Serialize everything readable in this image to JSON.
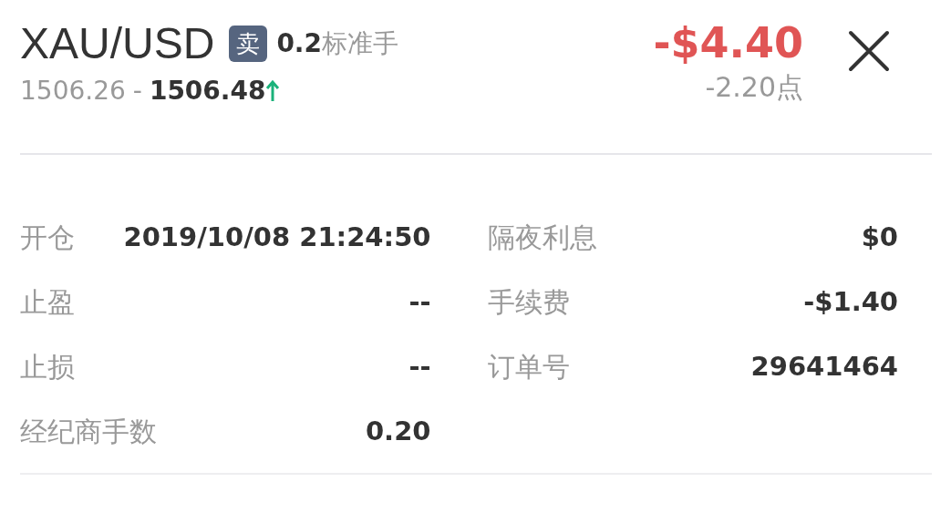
{
  "header": {
    "symbol": "XAU/USD",
    "side": {
      "label": "卖",
      "kind": "sell"
    },
    "lots": "0.2",
    "lot_unit": "标准手",
    "bid": "1506.26",
    "separator": "-",
    "ask": "1506.48",
    "rising": true,
    "profit": "-$4.40",
    "loss": true,
    "points": "-2.20点"
  },
  "details_left": [
    {
      "label": "开仓",
      "value": "2019/10/08 21:24:50"
    },
    {
      "label": "止盈",
      "value": "--"
    },
    {
      "label": "止损",
      "value": "--"
    },
    {
      "label": "经纪商手数",
      "value": "0.20"
    }
  ],
  "details_right": [
    {
      "label": "隔夜利息",
      "value": "$0"
    },
    {
      "label": "手续费",
      "value": "-$1.40"
    },
    {
      "label": "订单号",
      "value": "29641464"
    }
  ]
}
